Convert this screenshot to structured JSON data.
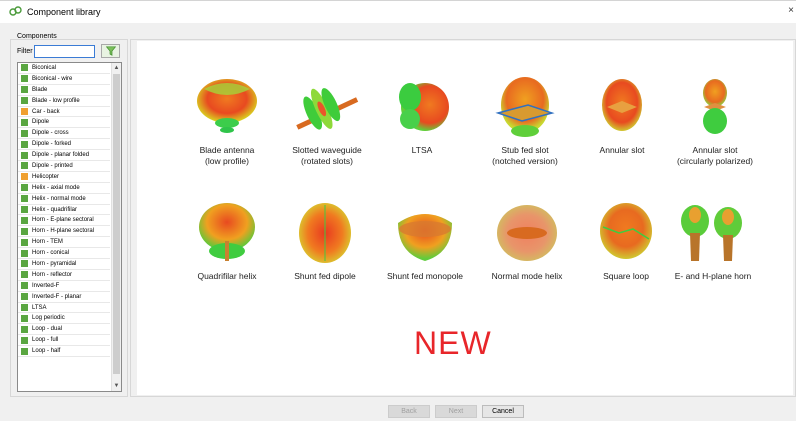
{
  "window": {
    "title": "Component library",
    "close_glyph": "×"
  },
  "components": {
    "group_label": "Components",
    "filter_label": "Filter",
    "filter_value": "",
    "filter_icon": "funnel-icon",
    "items": [
      {
        "label": "Biconical",
        "color": "#5aa641"
      },
      {
        "label": "Biconical - wire",
        "color": "#5aa641"
      },
      {
        "label": "Blade",
        "color": "#5aa641"
      },
      {
        "label": "Blade - low profile",
        "color": "#5aa641"
      },
      {
        "label": "Car - back",
        "color": "#f0a030"
      },
      {
        "label": "Dipole",
        "color": "#5aa641"
      },
      {
        "label": "Dipole - cross",
        "color": "#5aa641"
      },
      {
        "label": "Dipole - forked",
        "color": "#5aa641"
      },
      {
        "label": "Dipole - planar folded",
        "color": "#5aa641"
      },
      {
        "label": "Dipole - printed",
        "color": "#5aa641"
      },
      {
        "label": "Helicopter",
        "color": "#f0a030"
      },
      {
        "label": "Helix - axial mode",
        "color": "#5aa641"
      },
      {
        "label": "Helix - normal mode",
        "color": "#5aa641"
      },
      {
        "label": "Helix - quadrifilar",
        "color": "#5aa641"
      },
      {
        "label": "Horn - E-plane sectoral",
        "color": "#5aa641"
      },
      {
        "label": "Horn - H-plane sectoral",
        "color": "#5aa641"
      },
      {
        "label": "Horn - TEM",
        "color": "#5aa641"
      },
      {
        "label": "Horn - conical",
        "color": "#5aa641"
      },
      {
        "label": "Horn - pyramidal",
        "color": "#5aa641"
      },
      {
        "label": "Horn - reflector",
        "color": "#5aa641"
      },
      {
        "label": "Inverted-F",
        "color": "#5aa641"
      },
      {
        "label": "Inverted-F - planar",
        "color": "#5aa641"
      },
      {
        "label": "LTSA",
        "color": "#5aa641"
      },
      {
        "label": "Log periodic",
        "color": "#5aa641"
      },
      {
        "label": "Loop - dual",
        "color": "#5aa641"
      },
      {
        "label": "Loop - full",
        "color": "#5aa641"
      },
      {
        "label": "Loop - half",
        "color": "#5aa641"
      }
    ]
  },
  "gallery": {
    "tiles": [
      {
        "label": "Blade antenna\n(low profile)",
        "icon": "blade-antenna-pattern-icon"
      },
      {
        "label": "Slotted waveguide\n(rotated slots)",
        "icon": "slotted-waveguide-pattern-icon"
      },
      {
        "label": "LTSA",
        "icon": "ltsa-pattern-icon"
      },
      {
        "label": "Stub fed slot\n(notched version)",
        "icon": "stub-fed-slot-pattern-icon"
      },
      {
        "label": "Annular slot",
        "icon": "annular-slot-pattern-icon"
      },
      {
        "label": "Annular slot\n(circularly polarized)",
        "icon": "annular-slot-cp-pattern-icon"
      },
      {
        "label": "Quadrifilar helix",
        "icon": "quadrifilar-helix-pattern-icon"
      },
      {
        "label": "Shunt fed dipole",
        "icon": "shunt-fed-dipole-pattern-icon"
      },
      {
        "label": "Shunt fed monopole",
        "icon": "shunt-fed-monopole-pattern-icon"
      },
      {
        "label": "Normal mode helix",
        "icon": "normal-mode-helix-pattern-icon"
      },
      {
        "label": "Square loop",
        "icon": "square-loop-pattern-icon"
      },
      {
        "label": "E- and H-plane horn",
        "icon": "horn-pattern-icon"
      }
    ],
    "new_badge": "NEW",
    "new_color": "#e8262a"
  },
  "buttons": {
    "back": "Back",
    "next": "Next",
    "cancel": "Cancel"
  }
}
